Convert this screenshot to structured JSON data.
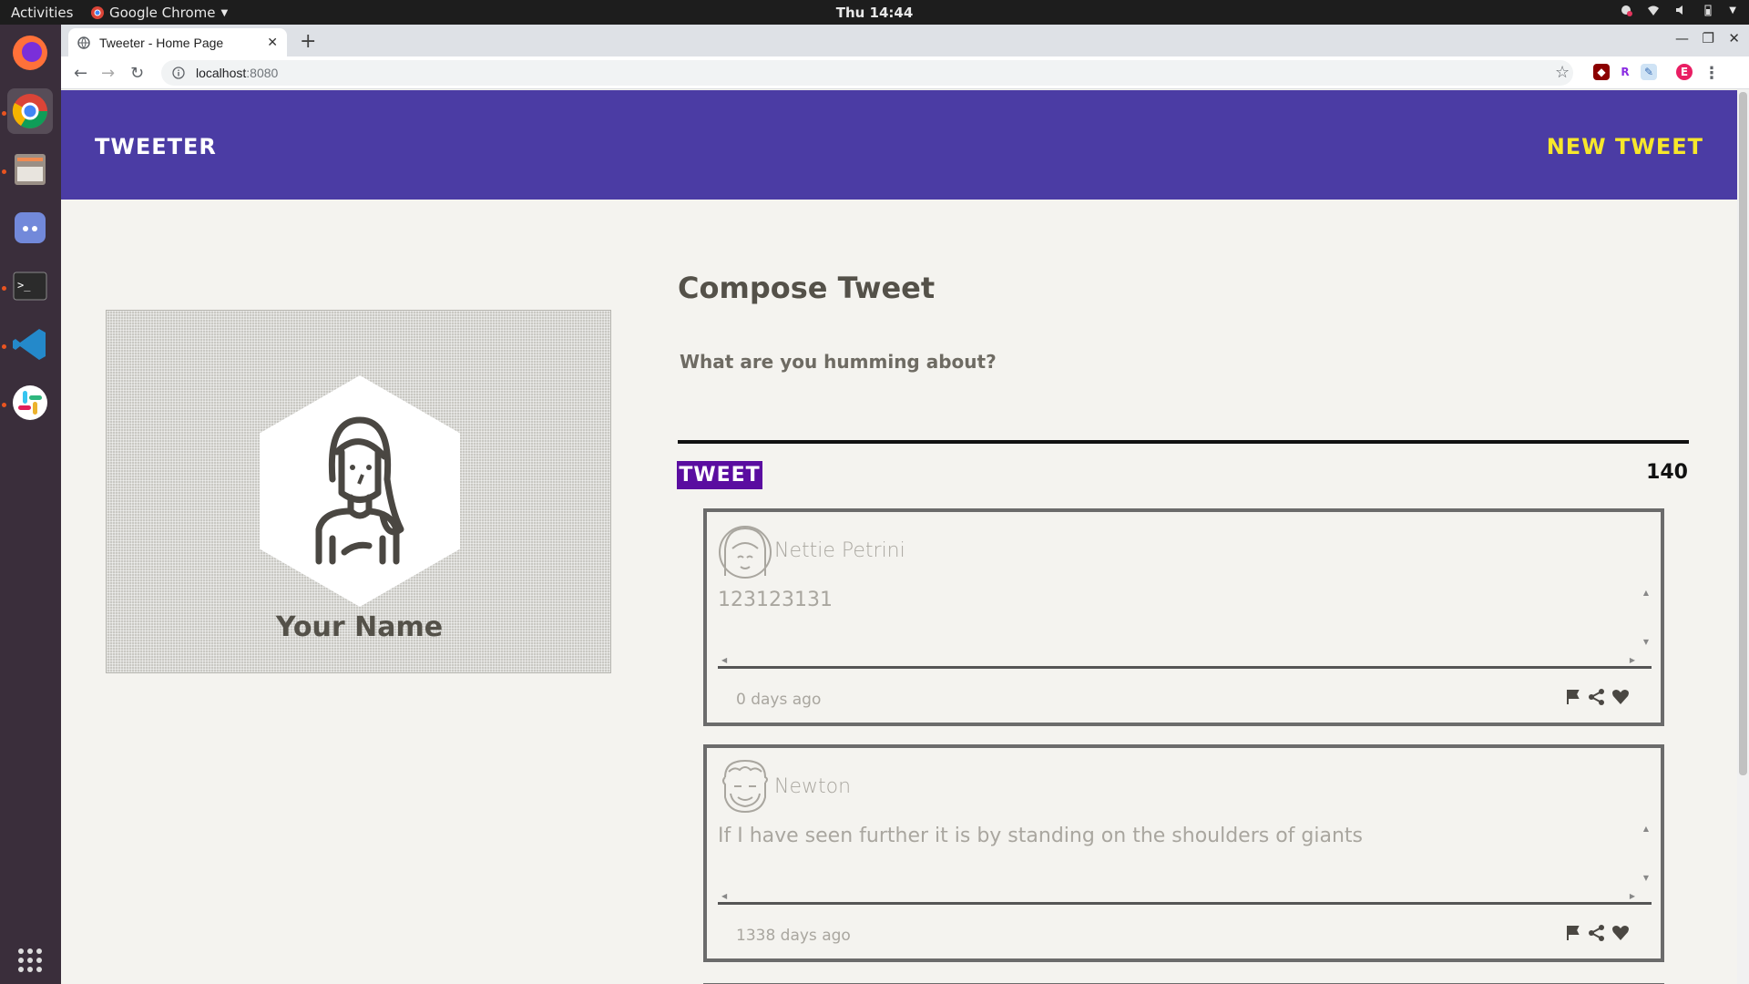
{
  "system": {
    "activities": "Activities",
    "app_name": "Google Chrome",
    "clock": "Thu 14:44"
  },
  "browser": {
    "tab_title": "Tweeter - Home Page",
    "url_host": "localhost",
    "url_port": ":8080",
    "profile_initial": "E",
    "ext_r": "R"
  },
  "nav": {
    "brand": "Tweeter",
    "new_tweet": "New Tweet"
  },
  "profile": {
    "name": "Your Name"
  },
  "compose": {
    "title": "Compose Tweet",
    "placeholder": "What are you humming about?",
    "tweet_button": "Tweet",
    "counter": "140"
  },
  "tweets": [
    {
      "author": "Nettie Petrini",
      "text": "123123131",
      "time": "0 days ago"
    },
    {
      "author": "Newton",
      "text": "If I have seen further it is by standing on the shoulders of giants",
      "time": "1338 days ago"
    }
  ],
  "icons": {
    "flag": "flag-icon",
    "share": "share-icon",
    "like": "heart-icon"
  },
  "colors": {
    "nav_bg": "#4b3ca4",
    "new_tweet": "#f7e72b",
    "tweet_button": "#5a0da0",
    "page_bg": "#f4f3ef"
  }
}
